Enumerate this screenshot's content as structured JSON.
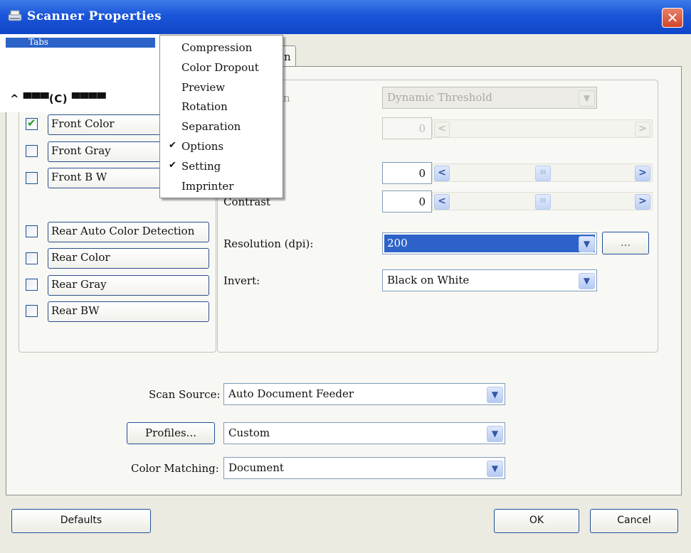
{
  "window": {
    "title": "Scanner Properties",
    "close_glyph": "✕"
  },
  "tabs": {
    "partial_label": "n"
  },
  "overlay": {
    "header_text": "Tabs",
    "ghost_text": "^ ▀▀▀(C)    ▀▀▀▀"
  },
  "context_menu": {
    "items": [
      {
        "label": "Compression",
        "checked": false
      },
      {
        "label": "Color Dropout",
        "checked": false
      },
      {
        "label": "Preview",
        "checked": false
      },
      {
        "label": "Rotation",
        "checked": false
      },
      {
        "label": "Separation",
        "checked": false
      },
      {
        "label": "Options",
        "checked": true
      },
      {
        "label": "Setting",
        "checked": true
      },
      {
        "label": "Imprinter",
        "checked": false
      }
    ],
    "check_glyph": "✔"
  },
  "image_types": {
    "items": [
      {
        "label": "Front Color",
        "checked": true
      },
      {
        "label": "Front Gray",
        "checked": false
      },
      {
        "label": "Front B W",
        "checked": false
      },
      {
        "label": "Rear Auto Color Detection",
        "checked": false
      },
      {
        "label": "Rear Color",
        "checked": false
      },
      {
        "label": "Rear Gray",
        "checked": false
      },
      {
        "label": "Rear BW",
        "checked": false
      }
    ]
  },
  "settings": {
    "binarization": {
      "label_fragment": "n",
      "value": "Dynamic Threshold"
    },
    "threshold": {
      "value": "0"
    },
    "brightness": {
      "value": "0"
    },
    "contrast": {
      "label": "Contrast",
      "value": "0"
    },
    "resolution": {
      "label": "Resolution (dpi):",
      "value": "200",
      "more_label": "..."
    },
    "invert": {
      "label": "Invert:",
      "value": "Black on White"
    }
  },
  "scan_source": {
    "label": "Scan Source:",
    "value": "Auto Document Feeder"
  },
  "profiles": {
    "button_label": "Profiles...",
    "value": "Custom"
  },
  "color_matching": {
    "label": "Color Matching:",
    "value": "Document"
  },
  "footer": {
    "defaults_label": "Defaults",
    "ok_label": "OK",
    "cancel_label": "Cancel"
  },
  "glyphs": {
    "dropdown": "▼",
    "left": "<",
    "right": ">",
    "thumb": "III"
  },
  "colors": {
    "titlebar": "#1a55d9",
    "selection": "#2d63c8",
    "check": "#21a121"
  }
}
